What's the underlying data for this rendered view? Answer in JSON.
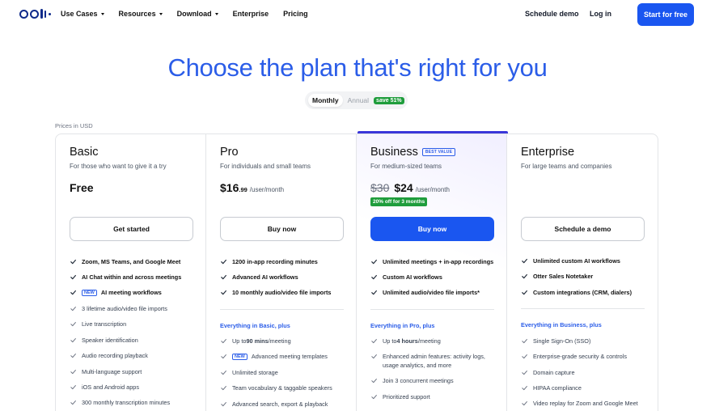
{
  "nav": {
    "logo_name": "otter-logo-icon",
    "items": [
      {
        "label": "Use Cases",
        "dropdown": true
      },
      {
        "label": "Resources",
        "dropdown": true
      },
      {
        "label": "Download",
        "dropdown": true
      },
      {
        "label": "Enterprise",
        "dropdown": false
      },
      {
        "label": "Pricing",
        "dropdown": false
      }
    ],
    "schedule_demo": "Schedule demo",
    "log_in": "Log in",
    "start_free": "Start for free"
  },
  "hero": {
    "title": "Choose the plan that's right for you",
    "toggle": {
      "monthly": "Monthly",
      "annual": "Annual",
      "save": "save 51%"
    },
    "prices_note": "Prices in USD"
  },
  "plans": [
    {
      "name": "Basic",
      "desc": "For those who want to give it a try",
      "price": "Free",
      "button": "Get started",
      "features": [
        {
          "text": "Zoom, MS Teams, and Google Meet",
          "bold": true
        },
        {
          "text": "AI Chat within and across meetings",
          "bold": true
        },
        {
          "text": "AI meeting workflows",
          "bold": true,
          "badge": "NEW"
        },
        {
          "text": "3 lifetime audio/video file imports",
          "bold": false
        },
        {
          "text": "Live transcription",
          "bold": false
        },
        {
          "text": "Speaker identification",
          "bold": false
        },
        {
          "text": "Audio recording playback",
          "bold": false
        },
        {
          "text": "Multi-language support",
          "bold": false
        },
        {
          "text": "iOS and Android apps",
          "bold": false
        },
        {
          "text": "300 monthly transcription minutes",
          "bold": false
        }
      ]
    },
    {
      "name": "Pro",
      "desc": "For individuals and small teams",
      "price_main": "$16",
      "price_cents": ".99",
      "per": "/user/month",
      "button": "Buy now",
      "features": [
        {
          "text": "1200 in-app recording minutes",
          "bold": true
        },
        {
          "text": "Advanced AI workflows",
          "bold": true
        },
        {
          "text": "10 monthly audio/video file imports",
          "bold": true
        }
      ],
      "section": "Everything in Basic, plus",
      "extras": [
        {
          "pre": "Up to ",
          "strong": "90 mins",
          "post": "/meeting"
        },
        {
          "text": "Advanced meeting templates",
          "badge": "NEW"
        },
        {
          "text": "Unlimited storage"
        },
        {
          "text": "Team vocabulary & taggable speakers"
        },
        {
          "text": "Advanced search, export & playback"
        }
      ]
    },
    {
      "name": "Business",
      "badge": "BEST VALUE",
      "desc": "For medium-sized teams",
      "old_price": "$30",
      "price_main": "$24",
      "per": "/user/month",
      "off": "20% off for 3 months",
      "button": "Buy now",
      "features": [
        {
          "text": "Unlimited meetings + in-app recordings",
          "bold": true
        },
        {
          "text": "Custom AI workflows",
          "bold": true
        },
        {
          "text": "Unlimited audio/video file imports*",
          "bold": true
        }
      ],
      "section": "Everything in Pro, plus",
      "extras": [
        {
          "pre": "Up to ",
          "strong": "4 hours",
          "post": "/meeting"
        },
        {
          "text": "Enhanced admin features: activity logs, usage analytics, and more"
        },
        {
          "text": "Join 3 concurrent meetings"
        },
        {
          "text": "Prioritized support"
        }
      ]
    },
    {
      "name": "Enterprise",
      "desc": "For large teams and companies",
      "button": "Schedule a demo",
      "features": [
        {
          "text": "Unlimited custom AI workflows",
          "bold": true
        },
        {
          "text": "Otter Sales Notetaker",
          "bold": true
        },
        {
          "text": "Custom integrations (CRM, dialers)",
          "bold": true
        }
      ],
      "section": "Everything in Business, plus",
      "extras": [
        {
          "text": "Single Sign-On (SSO)"
        },
        {
          "text": "Enterprise-grade security & controls"
        },
        {
          "text": "Domain capture"
        },
        {
          "text": "HIPAA compliance"
        },
        {
          "text": "Video replay for Zoom and Google Meet"
        }
      ]
    }
  ],
  "colors": {
    "accent": "#1a56f0",
    "title": "#2b5de8",
    "green": "#1f9d3c",
    "business_bar": "#3a36d9"
  }
}
